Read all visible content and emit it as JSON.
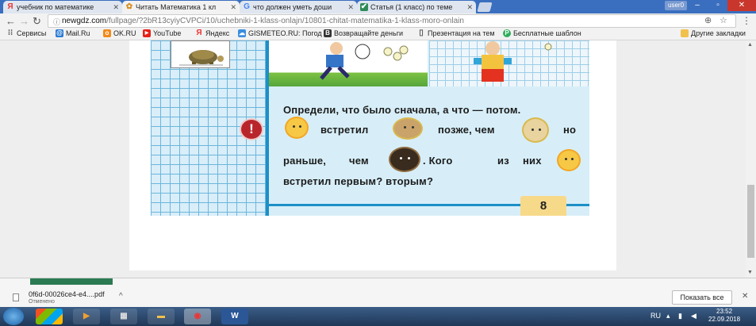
{
  "tabs": [
    {
      "label": "учебник по математике",
      "icon": "Я"
    },
    {
      "label": "Читать Математика 1 кл",
      "icon": "✿"
    },
    {
      "label": "что должен уметь доши",
      "icon": "G"
    },
    {
      "label": "Статья (1 класс) по теме",
      "icon": "✔"
    }
  ],
  "window": {
    "user": "user0"
  },
  "address": {
    "host": "newgdz.com",
    "path": "/fullpage/?2bR13cyiyCVPCi/10/uchebniki-1-klass-onlajn/10801-chitat-matematika-1-klass-moro-onlain"
  },
  "bookmarks": [
    {
      "label": "Сервисы"
    },
    {
      "label": "Mail.Ru"
    },
    {
      "label": "OK.RU"
    },
    {
      "label": "YouTube"
    },
    {
      "label": "Яндекс"
    },
    {
      "label": "GISMETEO.RU: Погод"
    },
    {
      "label": "Возвращайте деньги"
    },
    {
      "label": "Презентация на тем"
    },
    {
      "label": "Бесплатные шаблон"
    },
    {
      "label": "Другие закладки"
    }
  ],
  "book": {
    "line1": "Определи, что было сначала, а что — потом.",
    "line2a": "встретил",
    "line2b": "позже, чем",
    "line2c": "но",
    "line3a": "раньше,",
    "line3b": "чем",
    "line3c": ". Кого",
    "line3d": "из",
    "line3e": "них",
    "line4": "встретил первым? вторым?",
    "warn": "!",
    "page_number": "8"
  },
  "download": {
    "filename": "0f6d-00026ce4-e4....pdf",
    "status": "Отменено",
    "show_all": "Показать все"
  },
  "taskbar": {
    "time": "23:52",
    "date": "22.09.2018",
    "lang": "RU"
  }
}
